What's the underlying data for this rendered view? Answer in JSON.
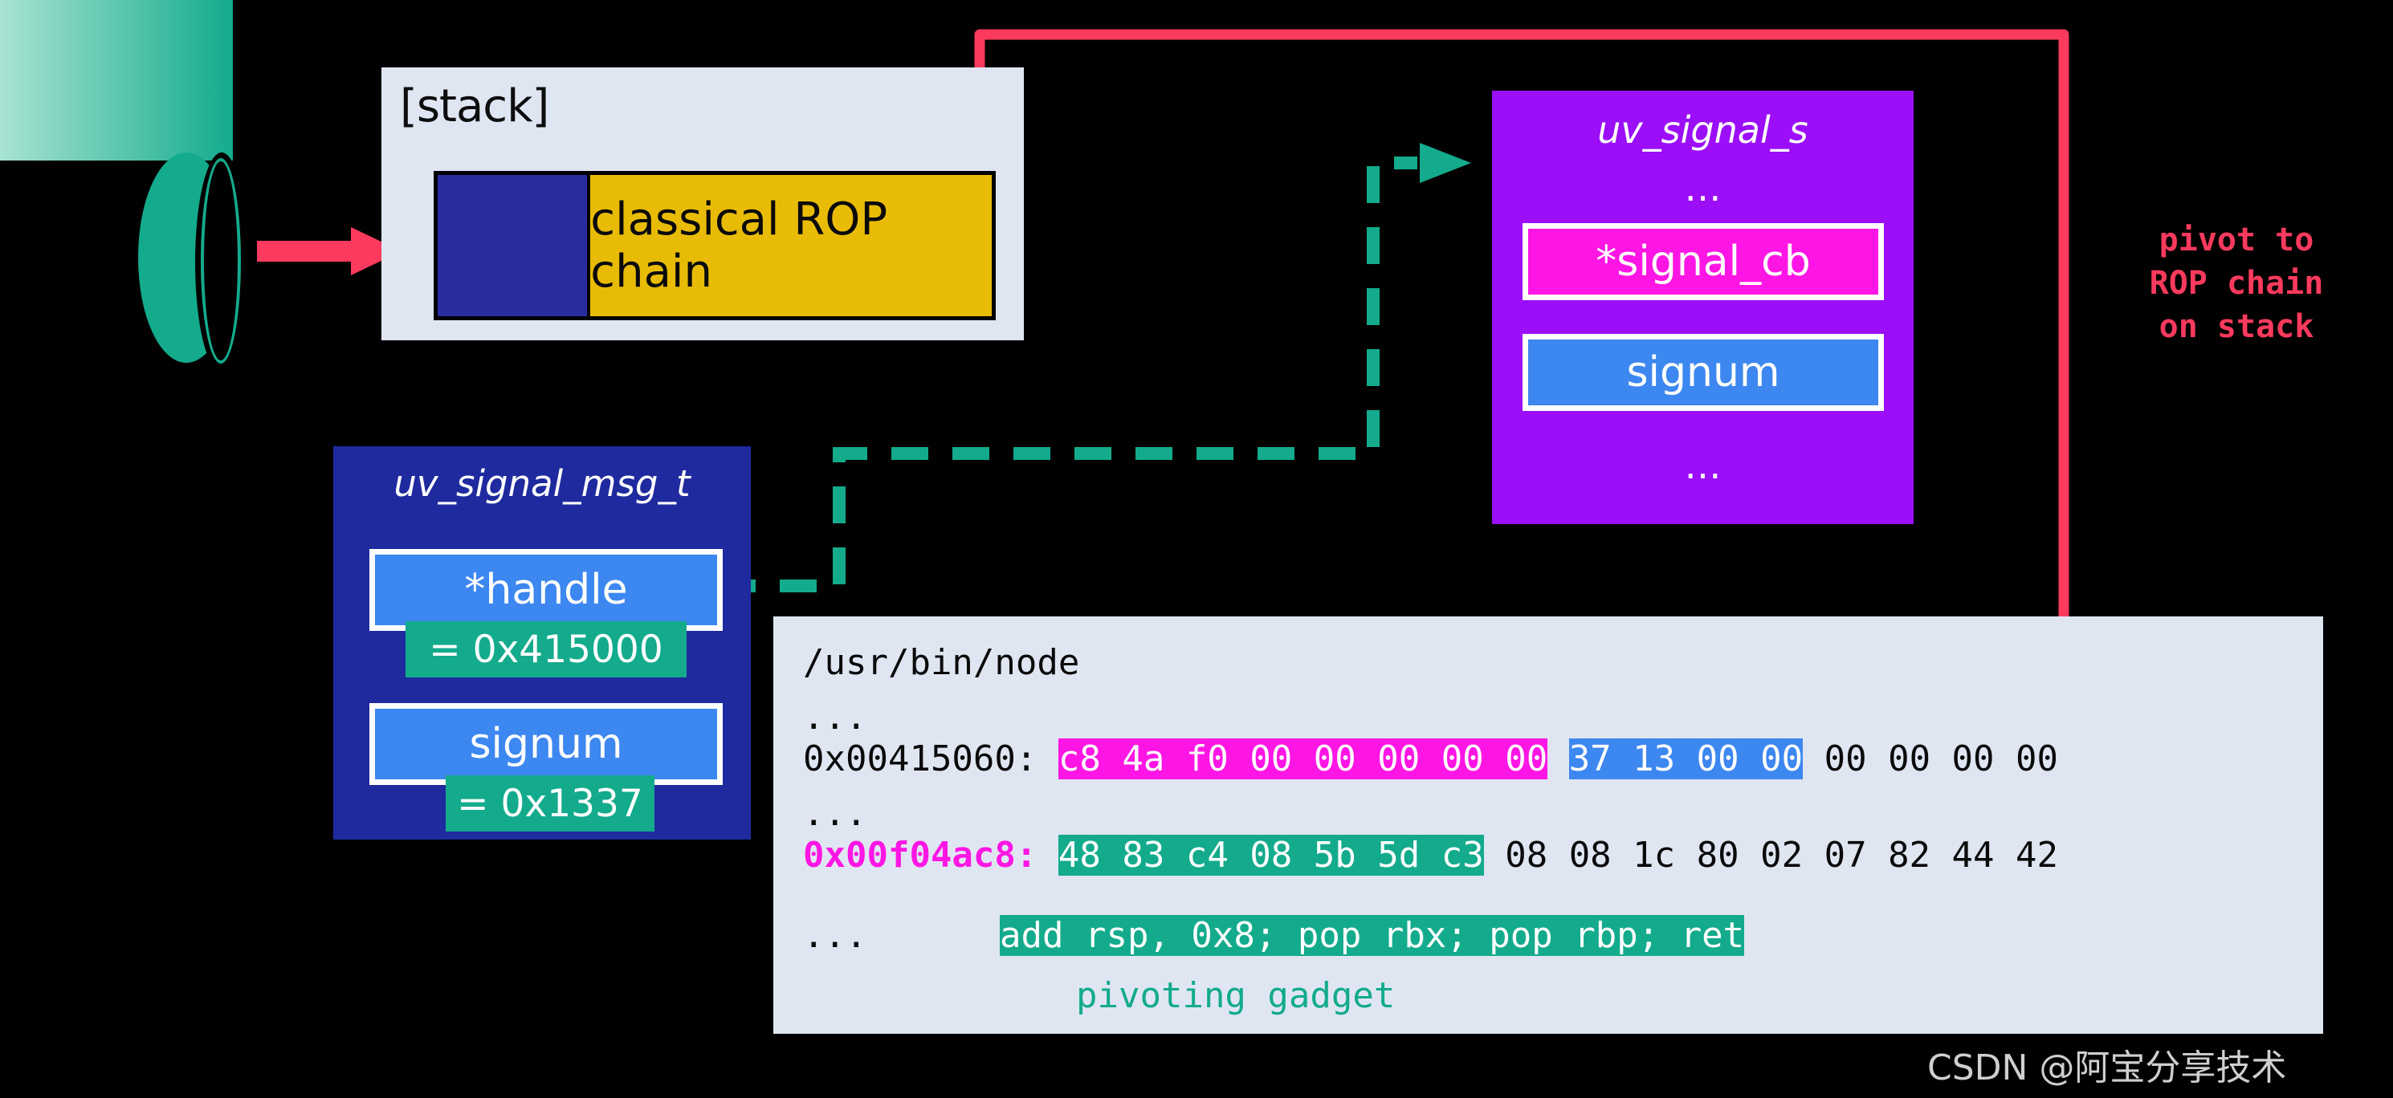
{
  "source": {
    "shape_name": "input-cylinder"
  },
  "stack": {
    "label": "[stack]",
    "cells": [
      {
        "name": "saved-registers",
        "text": ""
      },
      {
        "name": "rop-chain",
        "text": "classical ROP chain"
      }
    ]
  },
  "uv_signal_s": {
    "title": "uv_signal_s",
    "dots_top": "…",
    "signal_cb": "*signal_cb",
    "signum": "signum",
    "dots_bottom": "…"
  },
  "uv_signal_msg_t": {
    "title": "uv_signal_msg_t",
    "handle": "*handle",
    "handle_value": "= 0x415000",
    "signum": "signum",
    "signum_value": "= 0x1337"
  },
  "code_panel": {
    "path": "/usr/bin/node",
    "ellipsis": "...",
    "line1": {
      "address": "0x00415060:",
      "bytes_magenta": "c8 4a f0 00 00 00 00 00",
      "bytes_blue": "37 13 00 00",
      "bytes_plain_left": "00",
      "bytes_plain_right": "00 00 00"
    },
    "line2": {
      "address": "0x00f04ac8:",
      "bytes_teal": "48 83 c4 08 5b 5d c3",
      "bytes_plain_left": "08 08 1c 80 02 07",
      "bytes_plain_right": "82 44 42"
    },
    "asm": "add rsp, 0x8; pop rbx; pop rbp; ret",
    "gadget_caption": "pivoting gadget"
  },
  "annotations": {
    "pivot_note": "pivot to\nROP chain\non stack"
  },
  "watermark": "CSDN @阿宝分享技术",
  "colors": {
    "background": "#000000",
    "panel": "#dfe6f2",
    "red_arrow": "#fb3a5d",
    "teal": "#13ab8c",
    "purple": "#9b0ef7",
    "magenta": "#ff16e4",
    "blue": "#3d87f0",
    "dark_blue": "#1f2a9e",
    "yellow": "#e8bc06",
    "navy": "#2b2ca0"
  }
}
